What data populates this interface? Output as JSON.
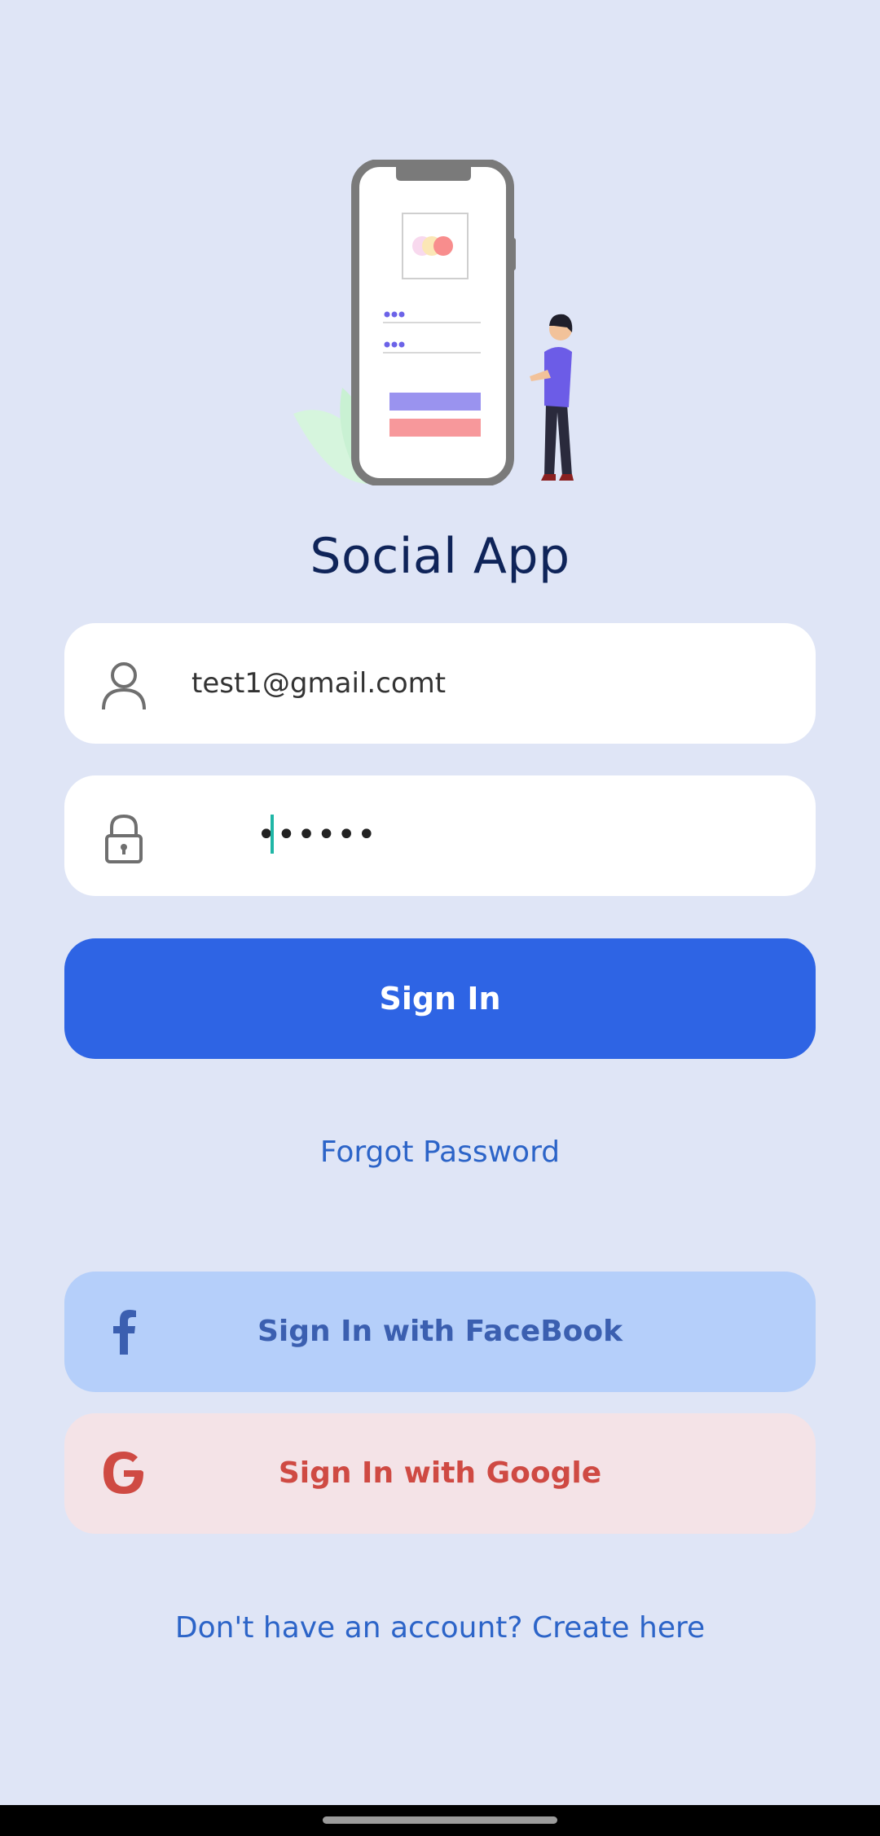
{
  "app": {
    "title": "Social App"
  },
  "login": {
    "email_value": "test1@gmail.comt",
    "password_mask": "••••••",
    "signin_label": "Sign In",
    "forgot_label": "Forgot Password"
  },
  "social": {
    "facebook_label": "Sign In with FaceBook",
    "google_label": "Sign In with Google"
  },
  "footer": {
    "create_label": "Don't have an account? Create here"
  },
  "icons": {
    "email": "user-icon",
    "password": "lock-icon",
    "facebook": "facebook-icon",
    "google": "google-icon"
  },
  "colors": {
    "background": "#dfe5f6",
    "primary": "#2e64e4",
    "link": "#2c64c8",
    "facebook_bg": "#b5cffa",
    "facebook_text": "#3b5fb0",
    "google_bg": "#f4e3e7",
    "google_text": "#cf4a43",
    "title": "#0f2459"
  }
}
